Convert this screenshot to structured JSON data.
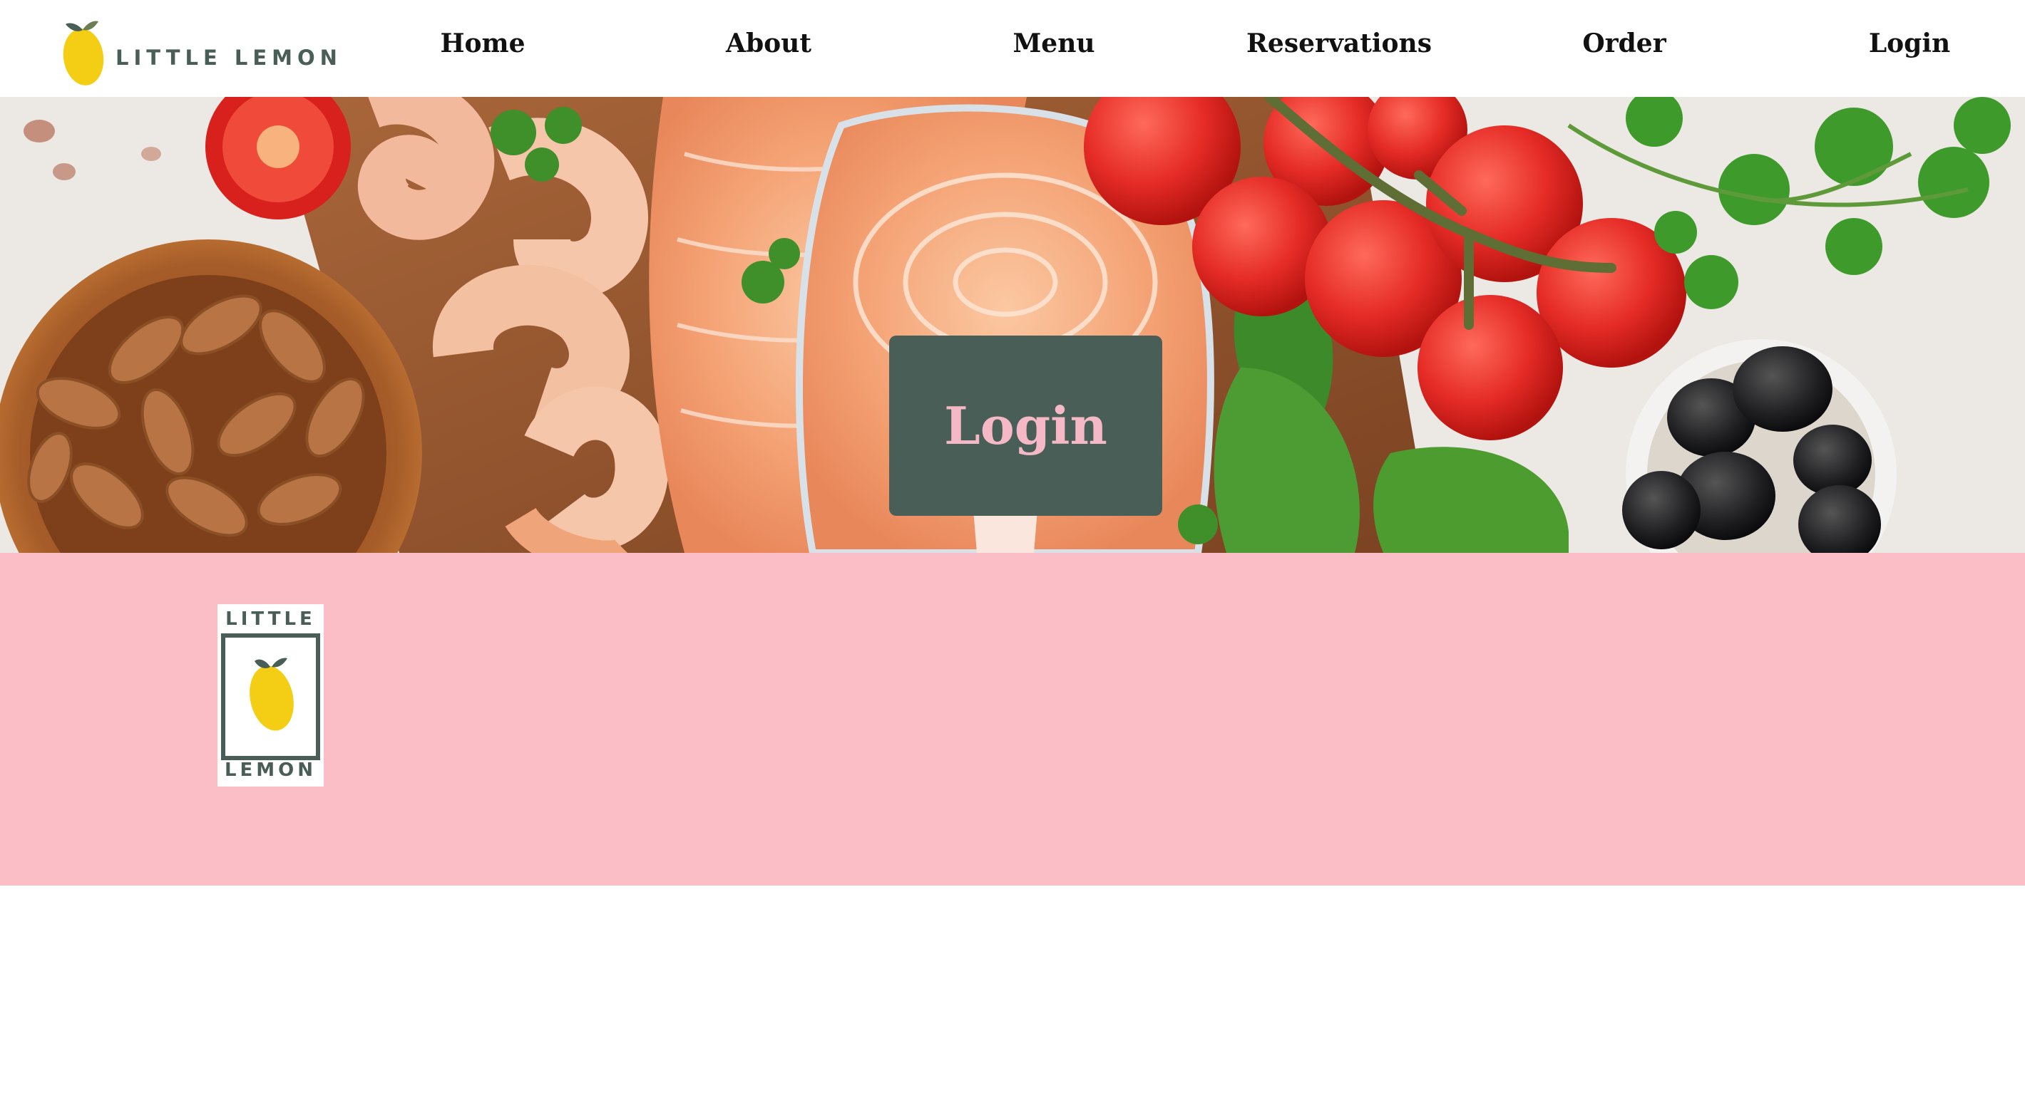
{
  "brand": {
    "name": "LITTLE LEMON",
    "icon": "lemon-icon"
  },
  "nav": {
    "home": "Home",
    "about": "About",
    "menu": "Menu",
    "reservations": "Reservations",
    "order": "Order",
    "login": "Login"
  },
  "hero": {
    "image": "food-spread-photo",
    "card_title": "Login"
  },
  "footer": {
    "logo_top": "LITTLE",
    "logo_bottom": "LEMON",
    "logo_icon": "lemon-icon"
  },
  "colors": {
    "primary_green": "#495e57",
    "pink": "#fbbec6",
    "lemon_yellow": "#f4ce14"
  }
}
